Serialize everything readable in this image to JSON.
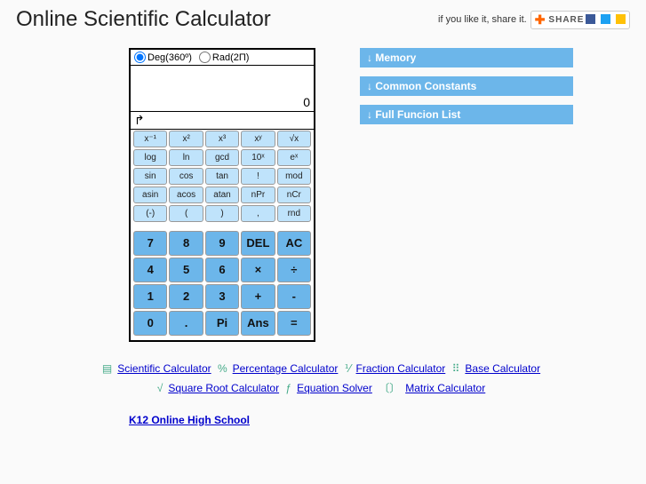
{
  "header": {
    "title": "Online Scientific Calculator",
    "share_text": "if you like it, share it.",
    "share_label": "SHARE"
  },
  "calc": {
    "mode": {
      "deg_label": "Deg(360º)",
      "rad_label": "Rad(2Π)",
      "selected": "deg"
    },
    "display_value": "0",
    "sub_display": "↱",
    "fkeys": [
      [
        "x⁻¹",
        "x²",
        "x³",
        "xʸ",
        "√x"
      ],
      [
        "log",
        "ln",
        "gcd",
        "10ˣ",
        "eˣ"
      ],
      [
        "sin",
        "cos",
        "tan",
        "!",
        "mod"
      ],
      [
        "asin",
        "acos",
        "atan",
        "nPr",
        "nCr"
      ],
      [
        "(-)",
        "(",
        ")",
        ",",
        "rnd"
      ]
    ],
    "nkeys": [
      [
        "7",
        "8",
        "9",
        "DEL",
        "AC"
      ],
      [
        "4",
        "5",
        "6",
        "×",
        "÷"
      ],
      [
        "1",
        "2",
        "3",
        "+",
        "-"
      ],
      [
        "0",
        ".",
        "Pi",
        "Ans",
        "="
      ]
    ]
  },
  "side": {
    "panels": [
      "↓ Memory",
      "↓ Common Constants",
      "↓ Full Funcion List"
    ]
  },
  "footer": {
    "row1": [
      "Scientific Calculator",
      "Percentage Calculator",
      "Fraction Calculator",
      "Base Calculator"
    ],
    "row2": [
      "Square Root Calculator",
      "Equation Solver",
      "Matrix Calculator"
    ],
    "ad": "K12 Online High School"
  }
}
